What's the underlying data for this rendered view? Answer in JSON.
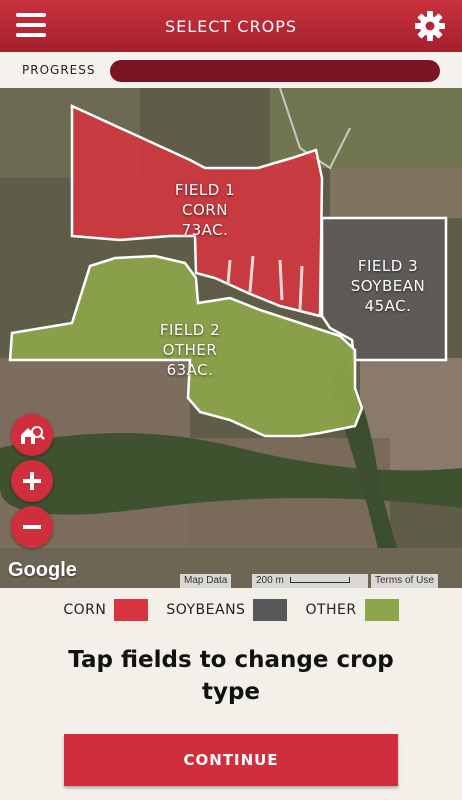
{
  "header": {
    "title": "SELECT CROPS",
    "menu_icon": "hamburger-menu-icon",
    "settings_icon": "gear-icon"
  },
  "progress": {
    "label": "PROGRESS",
    "value_fraction": 1.0,
    "color": "#7d1424"
  },
  "map": {
    "fields": [
      {
        "name": "FIELD 1",
        "crop": "CORN",
        "acres": "73AC.",
        "color": "#d8343f"
      },
      {
        "name": "FIELD 2",
        "crop": "OTHER",
        "acres": "63AC.",
        "color": "#8ea64a"
      },
      {
        "name": "FIELD 3",
        "crop": "SOYBEAN",
        "acres": "45AC.",
        "color": "#5d5a5a"
      }
    ],
    "controls": {
      "locate_icon": "farm-search-icon",
      "zoom_in_icon": "plus-icon",
      "zoom_out_icon": "minus-icon"
    },
    "google_logo": "Google",
    "map_data": "Map Data",
    "scale": "200 m",
    "terms": "Terms of Use"
  },
  "legend": [
    {
      "label": "CORN",
      "color": "#d8343f"
    },
    {
      "label": "SOYBEANS",
      "color": "#58585a"
    },
    {
      "label": "OTHER",
      "color": "#8ea64a"
    }
  ],
  "instruction": "Tap fields to change crop type",
  "continue_label": "CONTINUE",
  "colors": {
    "brand_red": "#cf2e3c",
    "header_dark": "#a51f2c"
  }
}
